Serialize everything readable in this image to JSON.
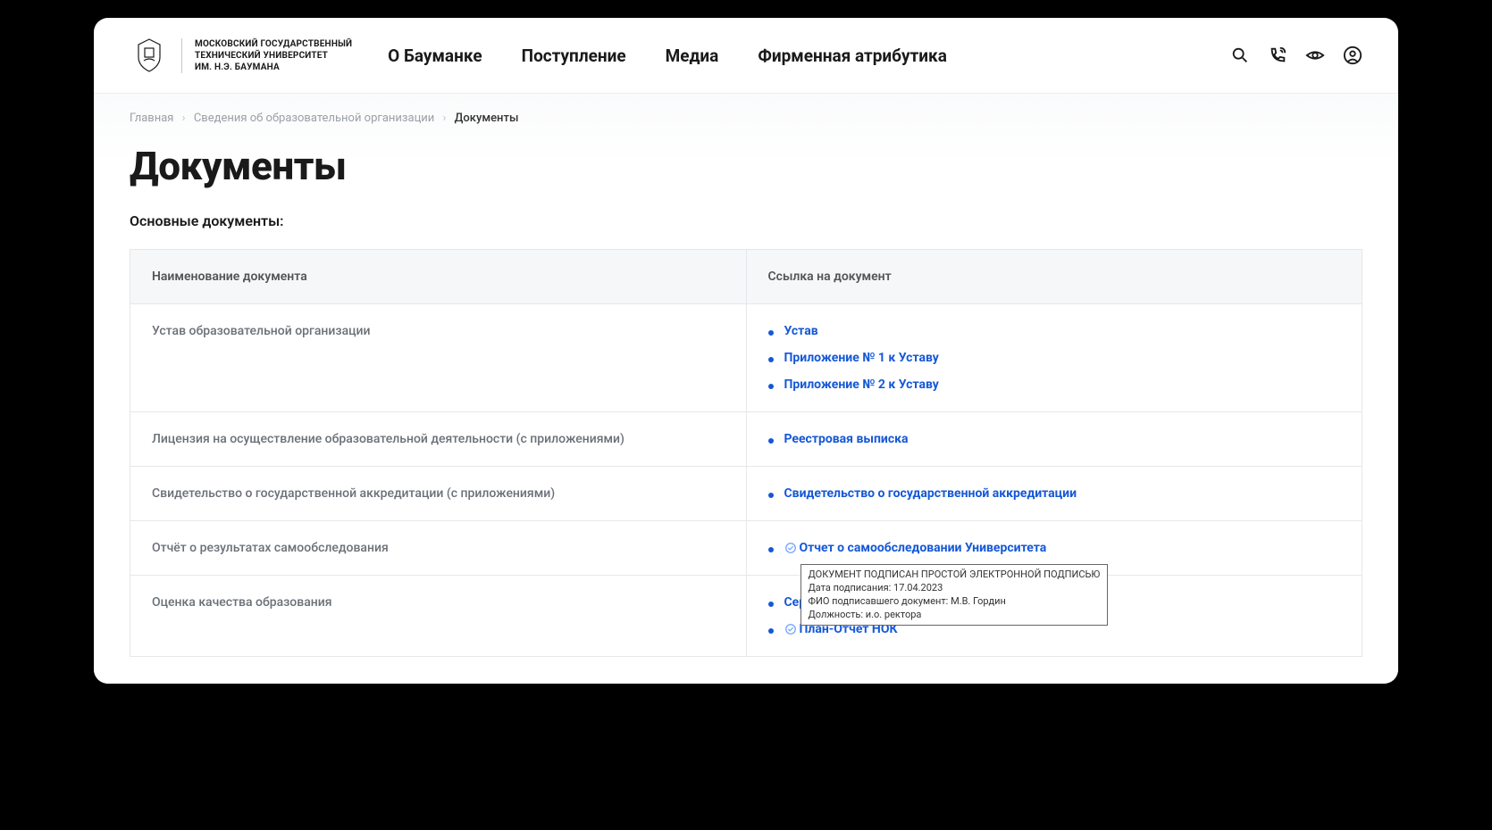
{
  "logo": {
    "line1": "МОСКОВСКИЙ ГОСУДАРСТВЕННЫЙ",
    "line2": "ТЕХНИЧЕСКИЙ УНИВЕРСИТЕТ",
    "line3": "ИМ. Н.Э. БАУМАНА"
  },
  "nav": {
    "item1": "О Бауманке",
    "item2": "Поступление",
    "item3": "Медиа",
    "item4": "Фирменная атрибутика"
  },
  "breadcrumb": {
    "home": "Главная",
    "parent": "Сведения об образовательной организации",
    "current": "Документы"
  },
  "page": {
    "title": "Документы",
    "subtitle": "Основные документы:"
  },
  "table": {
    "col1": "Наименование документа",
    "col2": "Ссылка на документ"
  },
  "rows": {
    "r1": {
      "name": "Устав образовательной организации",
      "links": {
        "l1": "Устав",
        "l2": "Приложение № 1 к Уставу",
        "l3": "Приложение № 2 к Уставу"
      }
    },
    "r2": {
      "name": "Лицензия на осуществление образовательной деятельности (с приложениями)",
      "links": {
        "l1": "Реестровая выписка"
      }
    },
    "r3": {
      "name": "Свидетельство о государственной аккредитации (с приложениями)",
      "links": {
        "l1": "Свидетельство о государственной аккредитации"
      }
    },
    "r4": {
      "name": "Отчёт о результатах самообследования",
      "links": {
        "l1": "Отчет о самообследовании Университета"
      }
    },
    "r5": {
      "name": "Оценка качества образования",
      "links": {
        "l1": "Сертификат НОК 2020",
        "l2": "План-Отчет НОК"
      }
    }
  },
  "signature": {
    "title": "ДОКУМЕНТ ПОДПИСАН ПРОСТОЙ ЭЛЕКТРОННОЙ ПОДПИСЬЮ",
    "date": "Дата подписания: 17.04.2023",
    "name": "ФИО подписавшего документ: М.В. Гордин",
    "position": "Должность: и.о. ректора"
  }
}
